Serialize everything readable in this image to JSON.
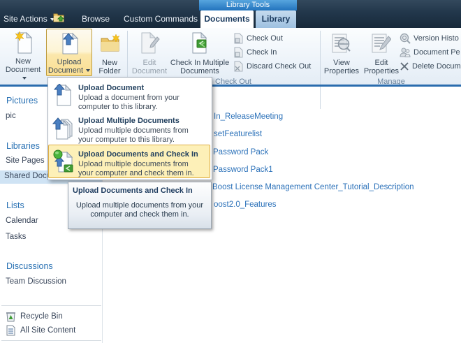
{
  "topbar": {
    "site_actions_label": "Site Actions",
    "browse_label": "Browse",
    "custom_commands_label": "Custom Commands",
    "library_tools_label": "Library Tools",
    "tab_documents": "Documents",
    "tab_library": "Library"
  },
  "ribbon": {
    "new_document": "New Document",
    "upload_document": "Upload Document",
    "new_folder": "New Folder",
    "edit_document": "Edit Document",
    "check_in_multiple": "Check In Multiple Documents",
    "check_out": "Check Out",
    "check_in": "Check In",
    "discard_check_out": "Discard Check Out",
    "view_properties": "View Properties",
    "edit_properties": "Edit Properties",
    "version_history": "Version Histo",
    "document_permissions": "Document Pe",
    "delete_document": "Delete Docum",
    "group_check_out": "Check Out",
    "group_manage": "Manage"
  },
  "upload_menu": {
    "items": [
      {
        "title": "Upload Document",
        "description": "Upload a document from your computer to this library.",
        "highlighted": false
      },
      {
        "title": "Upload Multiple Documents",
        "description": "Upload multiple documents from your computer to this library.",
        "highlighted": false
      },
      {
        "title": "Upload Documents and Check In",
        "description": "Upload multiple documents from your computer and check them in.",
        "highlighted": true
      }
    ]
  },
  "tooltip": {
    "title": "Upload Documents and Check In",
    "body": "Upload multiple documents from your computer and check them in."
  },
  "sidebar": {
    "sections": [
      {
        "heading": "Pictures",
        "items": [
          {
            "label": "pic",
            "selected": false
          }
        ]
      },
      {
        "heading": "Libraries",
        "items": [
          {
            "label": "Site Pages",
            "selected": false
          },
          {
            "label": "Shared Documents",
            "selected": true
          }
        ]
      },
      {
        "heading": "Lists",
        "items": [
          {
            "label": "Calendar",
            "selected": false
          },
          {
            "label": "Tasks",
            "selected": false
          }
        ]
      },
      {
        "heading": "Discussions",
        "items": [
          {
            "label": "Team Discussion",
            "selected": false
          }
        ]
      }
    ],
    "footer_items": [
      {
        "label": "Recycle Bin"
      },
      {
        "label": "All Site Content"
      }
    ]
  },
  "content": {
    "links": [
      "In_ReleaseMeeting",
      "setFeaturelist",
      "Password Pack",
      "Password Pack1",
      "Boost License Management Center_Tutorial_Description",
      "oost2.0_Features"
    ]
  },
  "colors": {
    "link_blue": "#2b71b9",
    "topbar_navy": "#22374b",
    "library_tools_blue": "#2d7cc2",
    "menu_highlight_amber": "#fdf0b8",
    "pressed_button_amber": "#fbdf92",
    "sidebar_selected_bg": "#cfe3f4",
    "ribbon_bottom_border": "#2a6cae"
  }
}
